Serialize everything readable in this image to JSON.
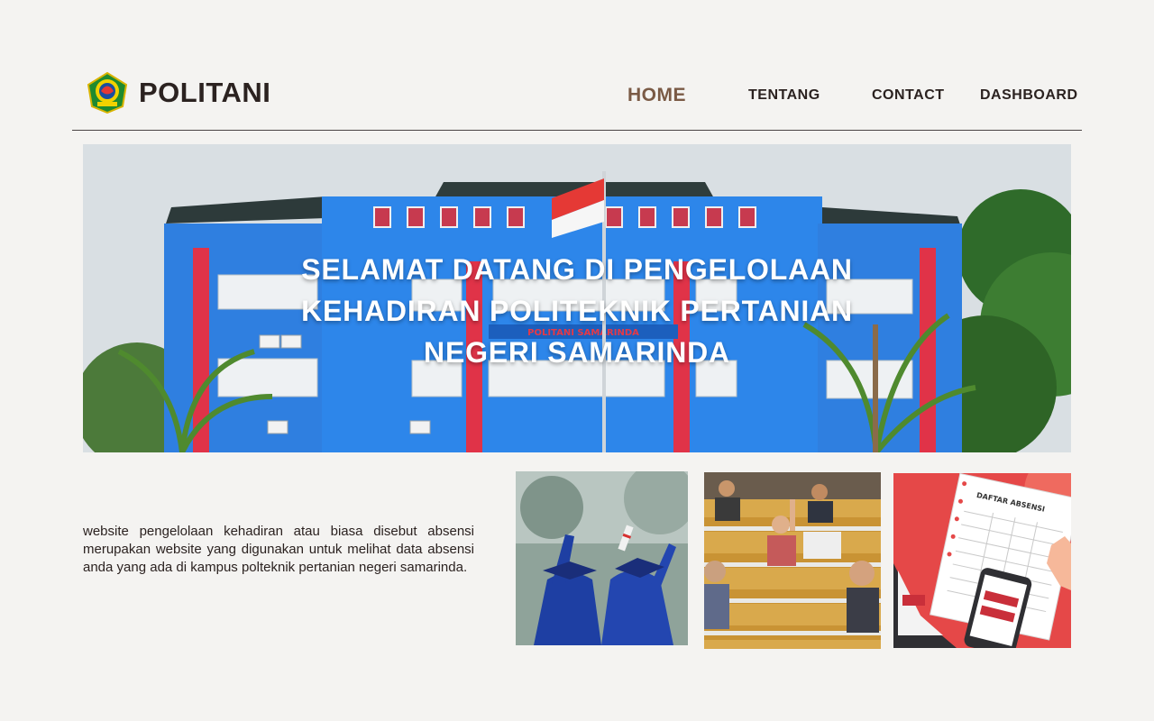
{
  "brand": {
    "name": "POLITANI",
    "logo_icon": "politani-emblem-icon"
  },
  "nav": {
    "items": [
      {
        "label": "HOME",
        "active": true
      },
      {
        "label": "TENTANG",
        "active": false
      },
      {
        "label": "CONTACT",
        "active": false
      },
      {
        "label": "DASHBOARD",
        "active": false
      }
    ]
  },
  "hero": {
    "title_lines": [
      "SELAMAT DATANG DI PENGELOLAAN",
      "KEHADIRAN POLITEKNIK PERTANIAN",
      "NEGERI SAMARINDA"
    ],
    "sign_text": "POLITANI SAMARINDA"
  },
  "intro": {
    "text": "website pengelolaan kehadiran atau biasa disebut absensi merupakan website yang digunakan untuk melihat data absensi anda yang ada di kampus polteknik pertanian negeri samarinda."
  },
  "thumbnails": [
    {
      "name": "graduation-photo"
    },
    {
      "name": "classroom-photo"
    },
    {
      "name": "attendance-illustration",
      "label": "DAFTAR ABSENSI"
    }
  ],
  "colors": {
    "background": "#f4f3f1",
    "text": "#2b2220",
    "nav_active": "#7a5a45"
  }
}
